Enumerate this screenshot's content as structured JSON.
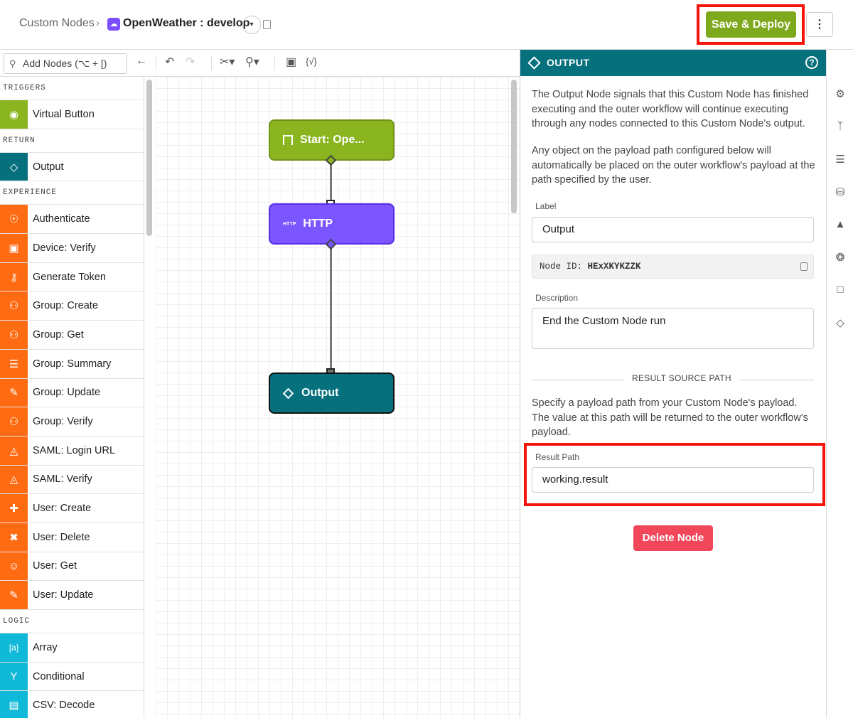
{
  "breadcrumb": {
    "root": "Custom Nodes",
    "separator": "›",
    "app_name": "OpenWeather : develop",
    "version_caret": "▾"
  },
  "header": {
    "save_label": "Save & Deploy",
    "more_label": "⋮"
  },
  "toolbar": {
    "search_placeholder": "Add Nodes (⌥ + [)",
    "expression_label": "{√}"
  },
  "sidebar": {
    "categories": [
      {
        "name": "TRIGGERS",
        "color": "#8ab51f",
        "items": [
          {
            "label": "Virtual Button",
            "icon": "radio-icon"
          }
        ]
      },
      {
        "name": "RETURN",
        "color": "#06707d",
        "items": [
          {
            "label": "Output",
            "icon": "diamond-icon"
          }
        ]
      },
      {
        "name": "EXPERIENCE",
        "color": "#ff6b12",
        "items": [
          {
            "label": "Authenticate",
            "icon": "fingerprint-icon"
          },
          {
            "label": "Device: Verify",
            "icon": "device-icon"
          },
          {
            "label": "Generate Token",
            "icon": "key-icon"
          },
          {
            "label": "Group: Create",
            "icon": "group-add-icon"
          },
          {
            "label": "Group: Get",
            "icon": "group-icon"
          },
          {
            "label": "Group: Summary",
            "icon": "group-summary-icon"
          },
          {
            "label": "Group: Update",
            "icon": "group-edit-icon"
          },
          {
            "label": "Group: Verify",
            "icon": "group-verify-icon"
          },
          {
            "label": "SAML: Login URL",
            "icon": "saml-icon"
          },
          {
            "label": "SAML: Verify",
            "icon": "saml-verify-icon"
          },
          {
            "label": "User: Create",
            "icon": "user-add-icon"
          },
          {
            "label": "User: Delete",
            "icon": "user-delete-icon"
          },
          {
            "label": "User: Get",
            "icon": "user-get-icon"
          },
          {
            "label": "User: Update",
            "icon": "user-edit-icon"
          }
        ]
      },
      {
        "name": "LOGIC",
        "color": "#10b9d8",
        "items": [
          {
            "label": "Array",
            "icon": "array-icon"
          },
          {
            "label": "Conditional",
            "icon": "branch-icon"
          },
          {
            "label": "CSV: Decode",
            "icon": "csv-icon"
          }
        ]
      }
    ]
  },
  "canvas": {
    "nodes": {
      "start": {
        "label": "Start: Ope...",
        "color": "#8ab51f"
      },
      "http": {
        "label": "HTTP",
        "badge": "HTTP",
        "color": "#7b55ff"
      },
      "output": {
        "label": "Output",
        "color": "#06707d"
      }
    }
  },
  "panel": {
    "title": "OUTPUT",
    "help": "?",
    "desc1": "The Output Node signals that this Custom Node has finished executing and the outer workflow will continue executing through any nodes connected to this Custom Node's output.",
    "desc2": "Any object on the payload path configured below will automatically be placed on the outer workflow's payload at the path specified by the user.",
    "label_field": {
      "label": "Label",
      "value": "Output"
    },
    "node_id": {
      "prefix": "Node ID:",
      "value": "HExXKYKZZK"
    },
    "description_field": {
      "label": "Description",
      "value": "End the Custom Node run"
    },
    "section_title": "RESULT SOURCE PATH",
    "section_desc": "Specify a payload path from your Custom Node's payload. The value at this path will be returned to the outer workflow's payload.",
    "result_path": {
      "label": "Result Path",
      "value": "working.result"
    },
    "delete_label": "Delete Node"
  },
  "colors": {
    "accent_green": "#7fa91d",
    "teal": "#06707d",
    "highlight": "#f5140a",
    "danger": "#f2465a"
  }
}
